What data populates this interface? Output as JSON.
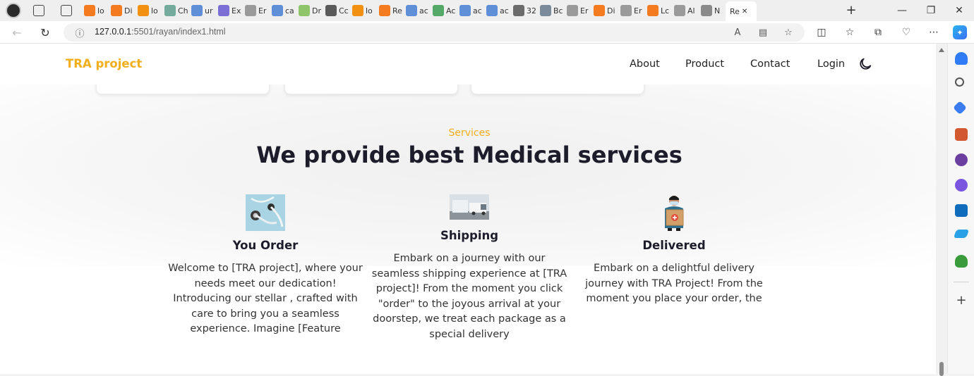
{
  "browser": {
    "tabs": [
      {
        "label": "lo",
        "color": "#f47b20"
      },
      {
        "label": "Di",
        "color": "#f47b20"
      },
      {
        "label": "lo",
        "color": "#f29111"
      },
      {
        "label": "Ch",
        "color": "#74aa9c"
      },
      {
        "label": "ur",
        "color": "#5f8fd6"
      },
      {
        "label": "Ex",
        "color": "#7b6fd6"
      },
      {
        "label": "Er",
        "color": "#9a9a9a"
      },
      {
        "label": "ca",
        "color": "#5f8fd6"
      },
      {
        "label": "Dr",
        "color": "#8fc56a"
      },
      {
        "label": "Cc",
        "color": "#5a5a5a"
      },
      {
        "label": "lo",
        "color": "#f29111"
      },
      {
        "label": "Re",
        "color": "#f47b20"
      },
      {
        "label": "ac",
        "color": "#5f8fd6"
      },
      {
        "label": "Ac",
        "color": "#54a868"
      },
      {
        "label": "ac",
        "color": "#5f8fd6"
      },
      {
        "label": "ac",
        "color": "#5f8fd6"
      },
      {
        "label": "32",
        "color": "#6b6b6b"
      },
      {
        "label": "Bc",
        "color": "#7a8a9a"
      },
      {
        "label": "Er",
        "color": "#9a9a9a"
      },
      {
        "label": "Di",
        "color": "#f47b20"
      },
      {
        "label": "Er",
        "color": "#9a9a9a"
      },
      {
        "label": "Lc",
        "color": "#f47b20"
      },
      {
        "label": "Al",
        "color": "#9a9a9a"
      },
      {
        "label": "N",
        "color": "#8a8a8a"
      }
    ],
    "active_tab": "Re",
    "url_host": "127.0.0.1",
    "url_rest": ":5501/rayan/index1.html"
  },
  "site": {
    "brand": "TRA project",
    "nav": [
      "About",
      "Product",
      "Contact",
      "Login"
    ],
    "section_label": "Services",
    "section_title": "We provide best Medical services",
    "services": [
      {
        "title": "You Order",
        "icon": "stethoscope-image",
        "text": "Welcome to [TRA project], where your needs meet our dedication! Introducing our stellar , crafted with care to bring you a seamless experience. Imagine [Feature"
      },
      {
        "title": "Shipping",
        "icon": "delivery-truck-image",
        "text": "Embark on a journey with our seamless shipping experience at [TRA project]! From the moment you click \"order\" to the joyous arrival at your doorstep, we treat each package as a special delivery"
      },
      {
        "title": "Delivered",
        "icon": "courier-with-package-image",
        "text": "Embark on a delightful delivery journey with TRA Project! From the moment you place your order, the"
      }
    ]
  },
  "colors": {
    "brand": "#f2ae1c",
    "heading": "#1d1c2b"
  }
}
